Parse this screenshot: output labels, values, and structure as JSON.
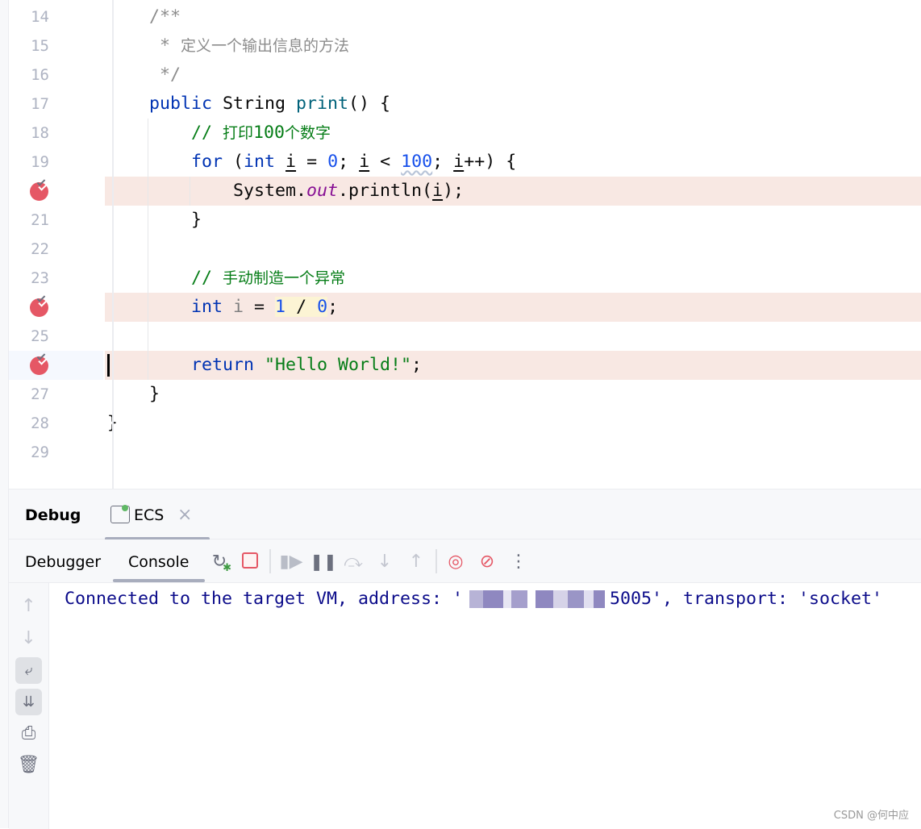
{
  "editor": {
    "lines": [
      {
        "n": "14",
        "tokens": [
          [
            "    /**",
            "cm"
          ]
        ]
      },
      {
        "n": "15",
        "tokens": [
          [
            "     * ",
            "cm"
          ],
          [
            "定义一个输出信息的方法",
            "cm cjk"
          ]
        ]
      },
      {
        "n": "16",
        "tokens": [
          [
            "     */",
            "cm"
          ]
        ]
      },
      {
        "n": "17",
        "tokens": [
          [
            "    public ",
            "kw"
          ],
          [
            "String ",
            ""
          ],
          [
            "print",
            "mth"
          ],
          [
            "() {",
            ""
          ]
        ]
      },
      {
        "n": "18",
        "tokens": [
          [
            "        // ",
            "lc"
          ],
          [
            "打印",
            "lc cjk"
          ],
          [
            "100",
            "lc"
          ],
          [
            "个数字",
            "lc cjk"
          ]
        ]
      },
      {
        "n": "19",
        "tokens": [
          [
            "        for ",
            "kw"
          ],
          [
            "(",
            ""
          ],
          [
            "int ",
            "kw"
          ],
          [
            "i",
            "var"
          ],
          [
            " = ",
            ""
          ],
          [
            "0",
            "num"
          ],
          [
            "; ",
            ""
          ],
          [
            "i",
            "var"
          ],
          [
            " < ",
            ""
          ],
          [
            "100",
            "num wavy"
          ],
          [
            "; ",
            ""
          ],
          [
            "i",
            "var"
          ],
          [
            "++) {",
            ""
          ]
        ]
      },
      {
        "n": "20",
        "breakpoint": true,
        "tokens": [
          [
            "            System.",
            ""
          ],
          [
            "out",
            "fld"
          ],
          [
            ".println(",
            ""
          ],
          [
            "i",
            "var"
          ],
          [
            ");",
            ""
          ]
        ]
      },
      {
        "n": "21",
        "tokens": [
          [
            "        }",
            ""
          ]
        ]
      },
      {
        "n": "22",
        "tokens": []
      },
      {
        "n": "23",
        "tokens": [
          [
            "        // ",
            "lc"
          ],
          [
            "手动制造一个异常",
            "lc cjk"
          ]
        ]
      },
      {
        "n": "24",
        "breakpoint": true,
        "tokens": [
          [
            "        int ",
            "kw"
          ],
          [
            "i",
            "unused"
          ],
          [
            " = ",
            ""
          ],
          [
            "1",
            "num hl"
          ],
          [
            " / ",
            "hl"
          ],
          [
            "0",
            "num hl"
          ],
          [
            ";",
            ""
          ]
        ]
      },
      {
        "n": "25",
        "tokens": []
      },
      {
        "n": "26",
        "breakpoint": true,
        "current": true,
        "tokens": [
          [
            "        return ",
            "kw"
          ],
          [
            "\"Hello World!\"",
            "str"
          ],
          [
            ";",
            ""
          ]
        ]
      },
      {
        "n": "27",
        "tokens": [
          [
            "    }",
            ""
          ]
        ]
      },
      {
        "n": "28",
        "tokens": [
          [
            "}",
            ""
          ]
        ]
      },
      {
        "n": "29",
        "tokens": []
      }
    ]
  },
  "debug": {
    "title": "Debug",
    "session_tab": "ECS",
    "close_icon": "×",
    "subtabs": {
      "debugger": "Debugger",
      "console": "Console"
    },
    "active_subtab": "Console",
    "toolbar_icons": [
      "rerun-debug-icon",
      "stop-icon",
      "resume-icon",
      "pause-icon",
      "step-over-icon",
      "step-into-icon",
      "step-out-icon",
      "view-breakpoints-icon",
      "mute-breakpoints-icon",
      "more-icon"
    ],
    "console": {
      "prefix": "Connected to the target VM, address: '",
      "suffix": "5005', transport: 'socket'"
    }
  },
  "colors": {
    "breakpoint": "#e55765",
    "stop": "#e55765",
    "keyword": "#0033b3",
    "string": "#067d17"
  },
  "watermark": "CSDN @何中应"
}
